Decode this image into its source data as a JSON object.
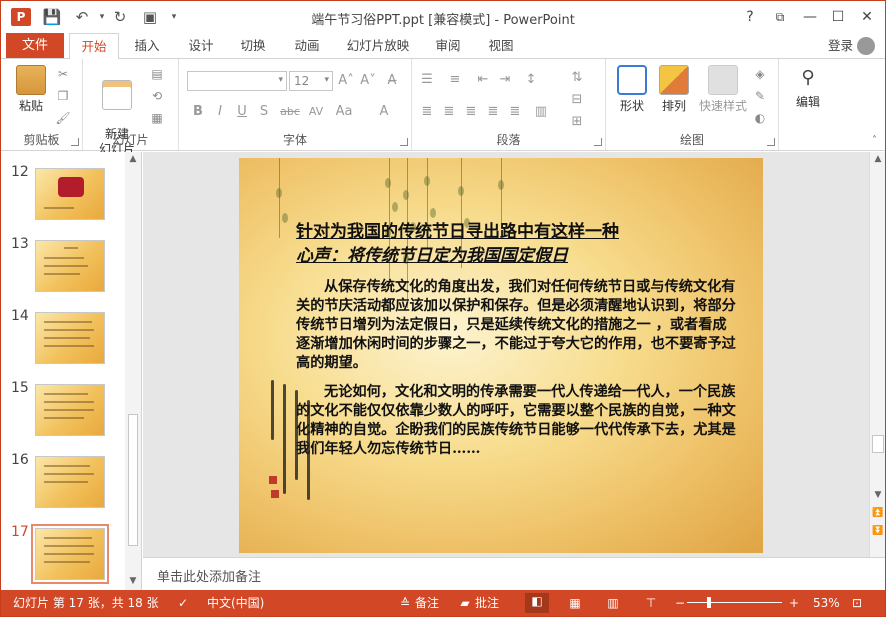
{
  "app": {
    "title": "端午节习俗PPT.ppt [兼容模式] - PowerPoint",
    "logo_letter": "P",
    "help": "?",
    "restore_ribbon": "⧉",
    "minimize": "—",
    "maximize": "☐",
    "close": "✕"
  },
  "qat": {
    "save": "💾",
    "undo": "↶",
    "redo": "↻",
    "present": "▣",
    "more": "▾"
  },
  "tabs": {
    "file": "文件",
    "items": [
      "开始",
      "插入",
      "设计",
      "切换",
      "动画",
      "幻灯片放映",
      "审阅",
      "视图"
    ],
    "active_index": 0,
    "login": "登录"
  },
  "ribbon": {
    "groups": [
      "剪贴板",
      "幻灯片",
      "字体",
      "段落",
      "绘图",
      "编辑"
    ],
    "paste": "粘贴",
    "new_slide": "新建\n幻灯片",
    "font_size": "12",
    "shape": "形状",
    "arrange": "排列",
    "quick_style": "快速样式",
    "edit": "编辑",
    "font_buttons": [
      "B",
      "I",
      "U",
      "S",
      "abc",
      "AV",
      "Aa",
      "A"
    ],
    "grow_font": "A˄",
    "shrink_font": "A˅",
    "clear_format": "A̶"
  },
  "thumbnails": {
    "numbers": [
      "12",
      "13",
      "14",
      "15",
      "16",
      "17"
    ],
    "active": "17"
  },
  "slide": {
    "title_line1": "针对为我国的传统节日寻出路中有这样一种",
    "title_line2": "心声：将传统节日定为我国国定假日",
    "para1": "从保存传统文化的角度出发，我们对任何传统节日或与传统文化有关的节庆活动都应该加以保护和保存。但是必须清醒地认识到，将部分传统节日增列为法定假日，只是延续传统文化的措施之一 ，或者看成逐渐增加休闲时间的步骤之一，不能过于夸大它的作用，也不要寄予过高的期望。",
    "para2": "无论如何，文化和文明的传承需要一代人传递给一代人，一个民族的文化不能仅仅依靠少数人的呼吁，它需要以整个民族的自觉，一种文化精神的自觉。企盼我们的民族传统节日能够一代代传承下去，尤其是我们年轻人勿忘传统节日……"
  },
  "notes": {
    "placeholder": "单击此处添加备注"
  },
  "status": {
    "slide_info": "幻灯片 第 17 张，共 18 张",
    "language": "中文(中国)",
    "notes_btn": "备注",
    "comments_btn": "批注",
    "zoom": "53%",
    "zoom_minus": "−",
    "zoom_plus": "+",
    "zoom_level": 0.53
  },
  "colors": {
    "accent": "#d24726",
    "status_bg": "#d24726"
  }
}
